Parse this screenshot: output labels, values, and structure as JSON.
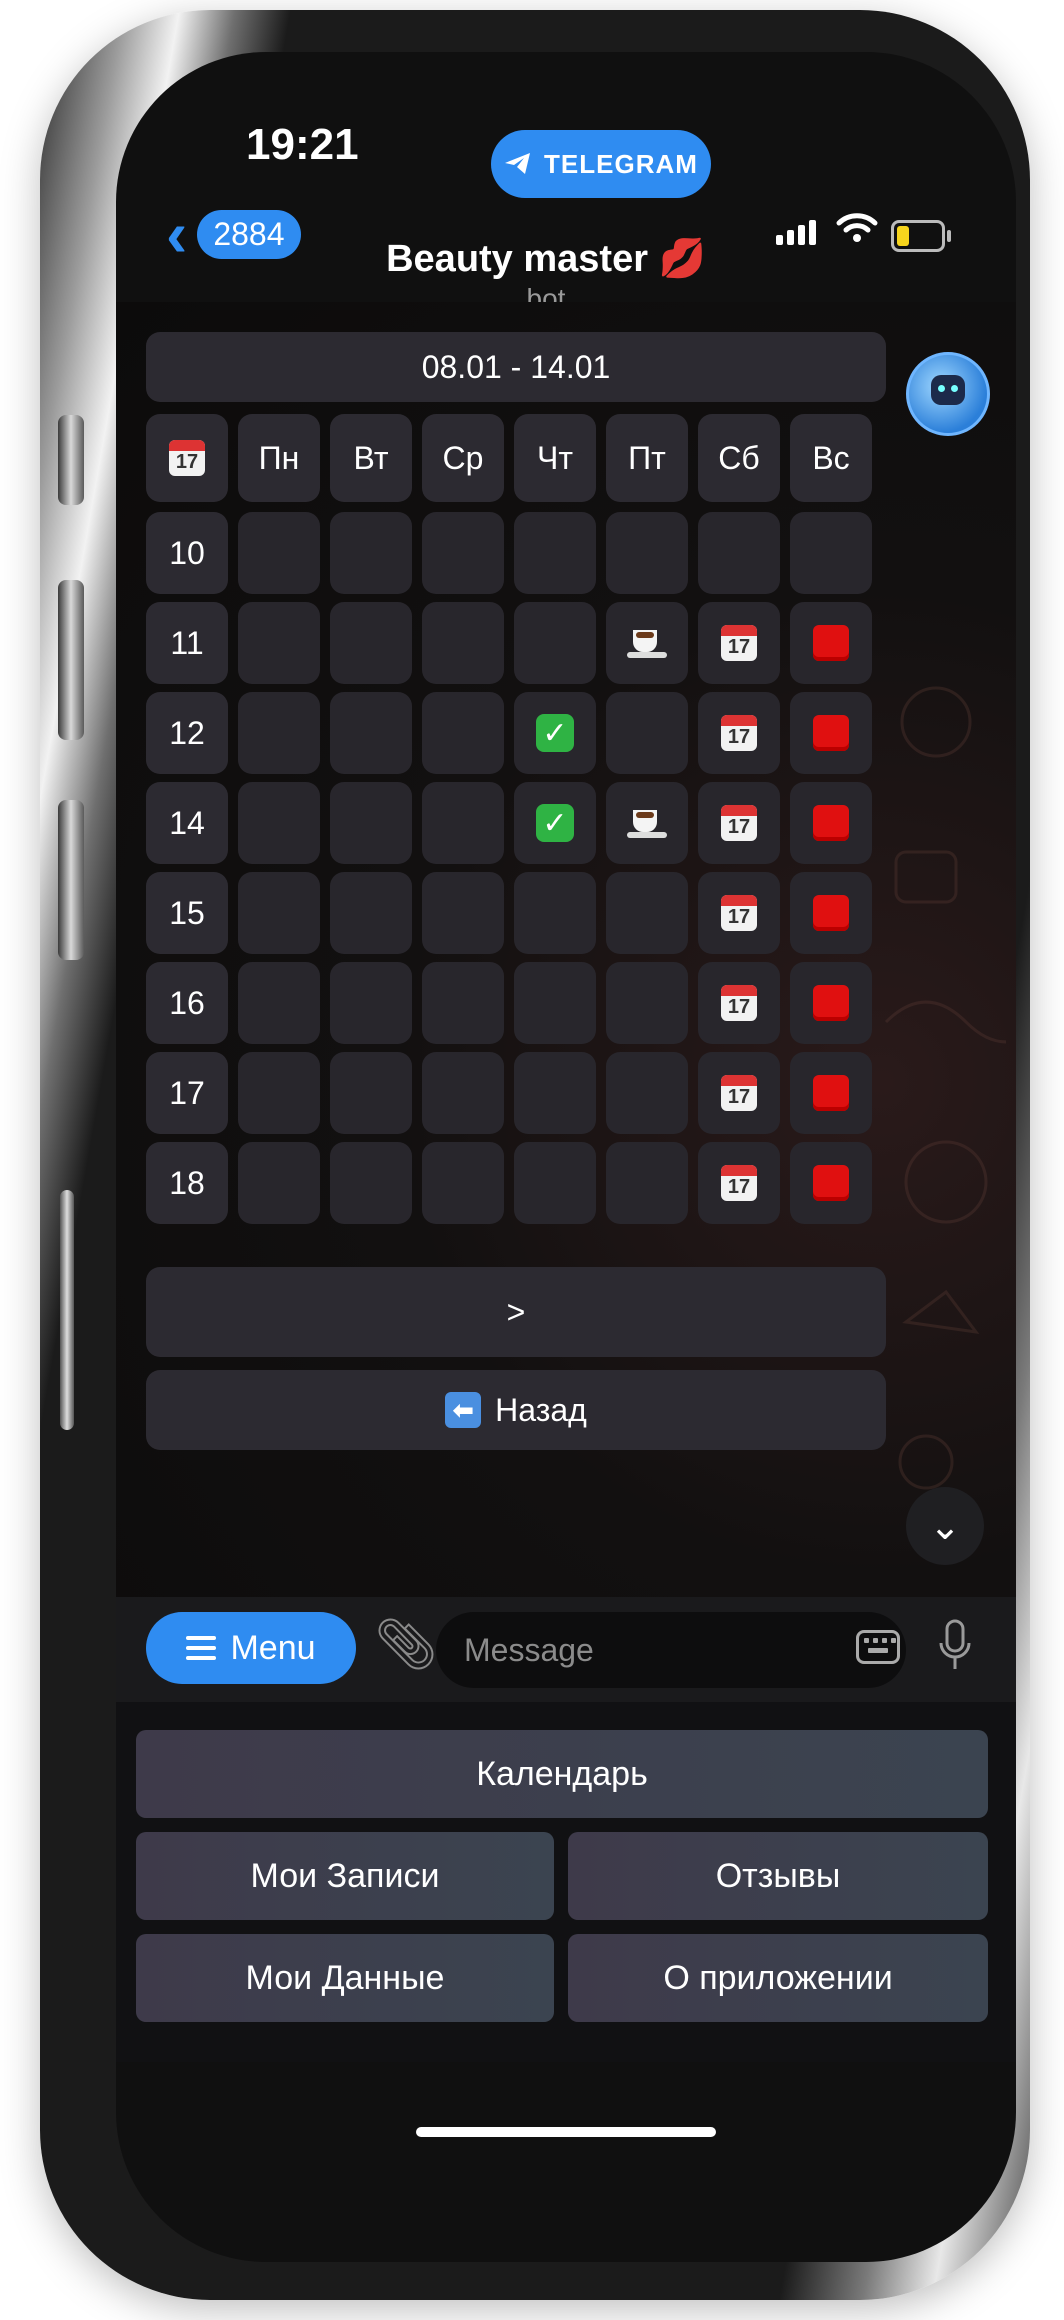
{
  "status_bar": {
    "time": "19:21",
    "source_pill": "TELEGRAM"
  },
  "header": {
    "back_count": "2884",
    "title": "Beauty master 💋",
    "subtitle": "bot"
  },
  "inline_keyboard": {
    "week_range": "08.01 - 14.01",
    "corner_icon": "calendar-icon",
    "corner_day": "17",
    "days": [
      "Пн",
      "Вт",
      "Ср",
      "Чт",
      "Пт",
      "Сб",
      "Вс"
    ],
    "hours": [
      "10",
      "11",
      "12",
      "14",
      "15",
      "16",
      "17",
      "18"
    ],
    "slots": [
      [
        "",
        "",
        "",
        "",
        "",
        "",
        ""
      ],
      [
        "",
        "",
        "",
        "",
        "coffee",
        "calendar",
        "red"
      ],
      [
        "",
        "",
        "",
        "check",
        "",
        "calendar",
        "red"
      ],
      [
        "",
        "",
        "",
        "check",
        "coffee",
        "calendar",
        "red"
      ],
      [
        "",
        "",
        "",
        "",
        "",
        "calendar",
        "red"
      ],
      [
        "",
        "",
        "",
        "",
        "",
        "calendar",
        "red"
      ],
      [
        "",
        "",
        "",
        "",
        "",
        "calendar",
        "red"
      ],
      [
        "",
        "",
        "",
        "",
        "",
        "calendar",
        "red"
      ]
    ],
    "next_label": ">",
    "back_label": "Назад"
  },
  "input_bar": {
    "menu_label": "Menu",
    "message_placeholder": "Message"
  },
  "reply_keyboard": {
    "calendar": "Календарь",
    "my_bookings": "Мои Записи",
    "reviews": "Отзывы",
    "my_data": "Мои Данные",
    "about": "О приложении"
  },
  "colors": {
    "accent": "#2f8cf1",
    "button_bg": "#2c2a31",
    "screen_bg": "#101010",
    "booked_red": "#e01010",
    "available_green": "#2fb344"
  }
}
